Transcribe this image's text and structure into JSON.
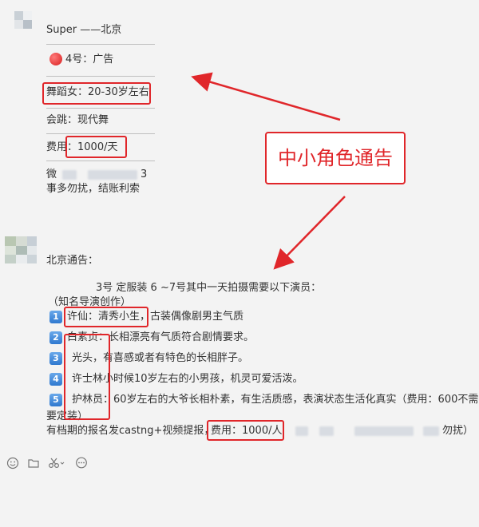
{
  "post1": {
    "title": "Super ——北京",
    "line_badge": "4号：广告",
    "line_role": "舞蹈女：20-30岁左右",
    "line_skill": "会跳：现代舞",
    "line_fee": "费用：1000/天",
    "line_contact_start": "微",
    "line_contact_end": "3",
    "line_contact2": "事多勿扰，结账利索"
  },
  "callout": {
    "text": "中小角色通告"
  },
  "post2": {
    "title": "北京通告：",
    "intro": "3号 定服装 6 ~7号其中一天拍摄需要以下演员：",
    "sub": "（知名导演创作）",
    "items": [
      {
        "num": "1",
        "text": "许仙：清秀小生，古装偶像剧男主气质"
      },
      {
        "num": "2",
        "text": "白素贞：长相漂亮有气质符合剧情要求。"
      },
      {
        "num": "3",
        "text": "光头，有喜感或者有特色的长相胖子。"
      },
      {
        "num": "4",
        "text": "许士林小时候10岁左右的小男孩，机灵可爱活泼。"
      },
      {
        "num": "5",
        "text": "护林员：60岁左右的大爷长相朴素，有生活质感，表演状态生活化真实（费用：600不需"
      }
    ],
    "item5_wrap": "要定装）",
    "footer_start": "有档期的报名发castng+视频提报，",
    "footer_fee": "费用：1000/人",
    "footer_end": "勿扰）"
  },
  "toolbar": {
    "emoji_icon": "emoji-icon",
    "folder_icon": "folder-icon",
    "scissors_icon": "scissors-icon",
    "chat_icon": "chat-bubble-icon"
  }
}
